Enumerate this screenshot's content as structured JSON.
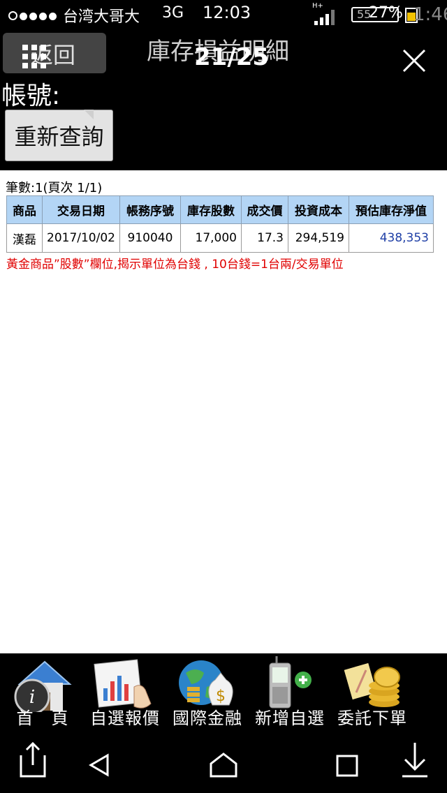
{
  "status_bar": {
    "carrier": "台湾大哥大",
    "network": "3G",
    "time": "12:03",
    "data_type": "H+",
    "battery_percent": "27%",
    "battery_level": 0.27,
    "background_battery_digits": "55",
    "background_time": "1:46"
  },
  "header": {
    "back_label": "返回",
    "title": "庫存損益明細",
    "page_counter": "21/25",
    "account_label": "帳號:",
    "requery_label": "重新查詢"
  },
  "content": {
    "record_count": "筆數:1(頁次 1/1)",
    "table": {
      "columns": [
        "商品",
        "交易日期",
        "帳務序號",
        "庫存股數",
        "成交價",
        "投資成本",
        "預估庫存淨值"
      ],
      "rows": [
        [
          "漢磊",
          "2017/10/02",
          "910040",
          "17,000",
          "17.3",
          "294,519",
          "438,353"
        ]
      ]
    },
    "gold_note": "黃金商品”股數”欄位,揭示單位為台錢 , 10台錢=1台兩/交易單位"
  },
  "toolbar": {
    "items": [
      {
        "label": "首　頁",
        "icon": "home-icon"
      },
      {
        "label": "自選報價",
        "icon": "chart-quote-icon"
      },
      {
        "label": "國際金融",
        "icon": "globe-money-icon"
      },
      {
        "label": "新增自選",
        "icon": "phone-add-icon"
      },
      {
        "label": "委託下單",
        "icon": "coins-order-icon"
      }
    ]
  },
  "colors": {
    "table_header_bg": "#b3d5f5",
    "note_red": "#e00000",
    "value_blue": "#1f3fa6"
  }
}
